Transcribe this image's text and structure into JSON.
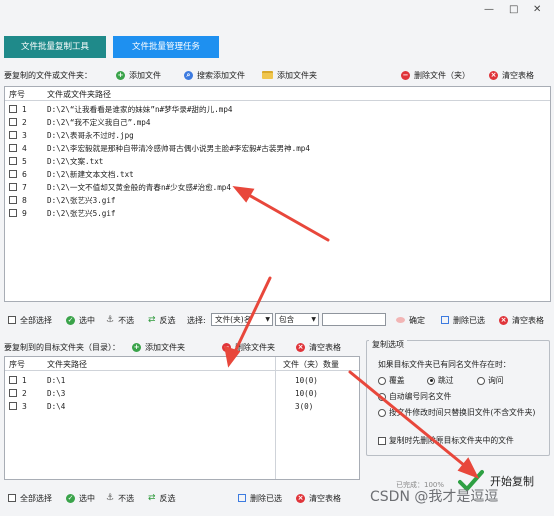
{
  "window": {
    "minimize": "—",
    "maximize": "□",
    "close": "✕"
  },
  "tabs": [
    {
      "label": "文件批量复制工具"
    },
    {
      "label": "文件批量管理任务"
    }
  ],
  "source": {
    "title": "要复制的文件或文件夹：",
    "add_file": "添加文件",
    "search_add_file": "搜索添加文件",
    "add_folder": "添加文件夹",
    "delete_file": "删除文件（夹）",
    "clear_table": "清空表格",
    "col_index": "序号",
    "col_path": "文件或文件夹路径",
    "rows": [
      {
        "n": "1",
        "path": "D:\\2\\“让我看看是谁家的妹妹”n#梦华录#甜的儿.mp4"
      },
      {
        "n": "2",
        "path": "D:\\2\\“我不定义我自己”.mp4"
      },
      {
        "n": "3",
        "path": "D:\\2\\表哥永不过时.jpg"
      },
      {
        "n": "4",
        "path": "D:\\2\\李宏毅就是那种自带清冷感帅哥古偶小说男主脸#李宏毅#古装男神.mp4"
      },
      {
        "n": "5",
        "path": "D:\\2\\文案.txt"
      },
      {
        "n": "6",
        "path": "D:\\2\\新建文本文档.txt"
      },
      {
        "n": "7",
        "path": "D:\\2\\一文不值却又黄金般的青春n#少女感#治愈.mp4"
      },
      {
        "n": "8",
        "path": "D:\\2\\张艺兴3.gif"
      },
      {
        "n": "9",
        "path": "D:\\2\\张艺兴5.gif"
      }
    ],
    "select_all": "全部选择",
    "select": "选中",
    "unselect": "不选",
    "invert": "反选",
    "choose_label": "选择:",
    "choose_type": "文件(夹)名",
    "match_mode": "包含",
    "confirm": "确定",
    "delete_selected": "删除已选",
    "clear_table2": "清空表格"
  },
  "target": {
    "title": "要复制到的目标文件夹（目录）：",
    "add_folder": "添加文件夹",
    "delete_folder": "删除文件夹",
    "clear_table": "清空表格",
    "col_index": "序号",
    "col_path": "文件夹路径",
    "col_count": "文件（夹）数量",
    "rows": [
      {
        "n": "1",
        "path": "D:\\1",
        "count": "10(0)"
      },
      {
        "n": "2",
        "path": "D:\\3",
        "count": "10(0)"
      },
      {
        "n": "3",
        "path": "D:\\4",
        "count": "3(0)"
      }
    ],
    "select_all": "全部选择",
    "select": "选中",
    "unselect": "不选",
    "invert": "反选",
    "delete_selected": "删除已选",
    "clear_table2": "清空表格"
  },
  "options": {
    "group_title": "复制选项",
    "conflict_label": "如果目标文件夹已有同名文件存在时：",
    "overwrite": "覆盖",
    "skip": "跳过",
    "ask": "询问",
    "auto_rename": "自动编号同名文件",
    "replace_old": "按文件修改时间只替换旧文件(不含文件夹)",
    "delete_before": "复制时先删除原目标文件夹中的文件"
  },
  "status": {
    "completed": "已完成：100%",
    "start_copy": "开始复制"
  },
  "watermark": "CSDN @我才是逗逗",
  "colors": {
    "tab1": "#1f8a8a",
    "tab2": "#1e90f0",
    "arrow": "#e8473b"
  }
}
